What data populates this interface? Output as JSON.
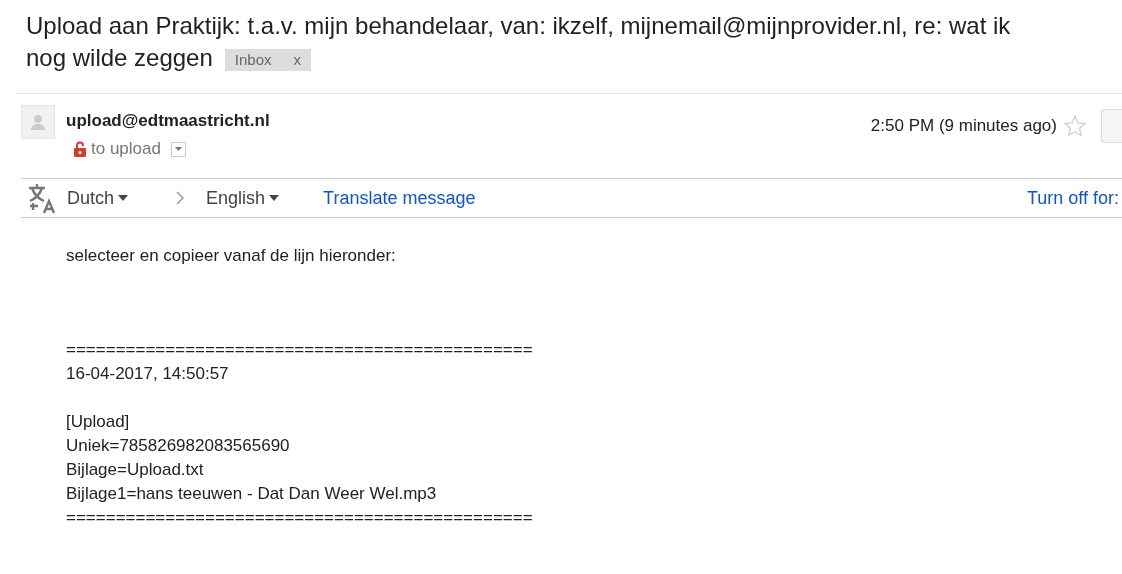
{
  "subject": {
    "title_lines": [
      "Upload aan Praktijk: t.a.v. mijn behandelaar, van: ikzelf, mijnemail@mijnprovider.nl, re: wat ik",
      "nog wilde zeggen"
    ],
    "label": "Inbox",
    "label_close": "x"
  },
  "message": {
    "sender": "upload@edtmaastricht.nl",
    "recipient": "to upload",
    "time": "2:50 PM (9 minutes ago)",
    "starred": false
  },
  "translate_bar": {
    "from": "Dutch",
    "to": "English",
    "action": "Translate message",
    "turn_off": "Turn off for:"
  },
  "body": [
    {
      "kind": "intro",
      "lines": [
        "selecteer en copieer vanaf de lijn hieronder:"
      ]
    },
    {
      "kind": "block",
      "lines": [
        "===============================================",
        "16-04-2017, 14:50:57"
      ]
    },
    {
      "kind": "para",
      "lines": [
        "[Upload]",
        "Uniek=785826982083565690",
        "Bijlage=Upload.txt",
        "Bijlage1=hans teeuwen - Dat Dan Weer Wel.mp3",
        "==============================================="
      ]
    }
  ]
}
